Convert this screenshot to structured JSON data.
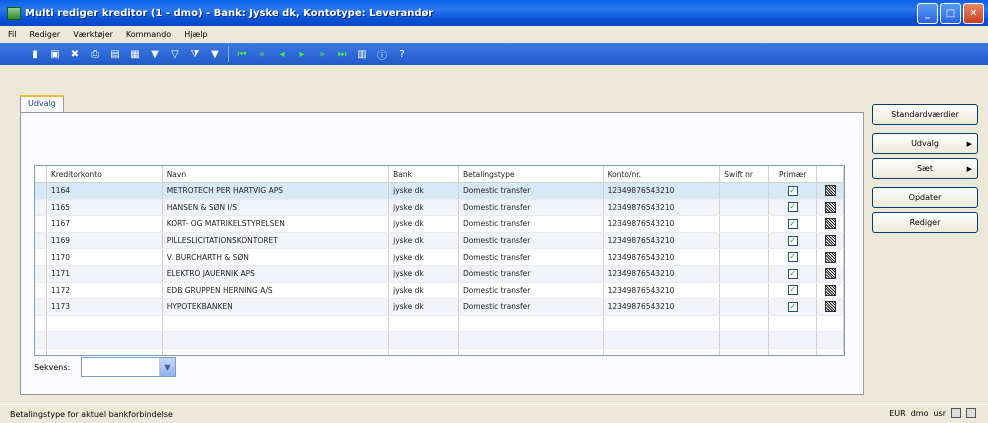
{
  "window": {
    "title": "Multi rediger kreditor (1 - dmo) - Bank: Jyske dk, Kontotype: Leverandør"
  },
  "menu": [
    "Fil",
    "Rediger",
    "Værktøjer",
    "Kommando",
    "Hjælp"
  ],
  "tab": {
    "label": "Udvalg"
  },
  "grid": {
    "columns": [
      "Kreditorkonto",
      "Navn",
      "Bank",
      "Betalingstype",
      "Konto/nr.",
      "Swift nr",
      "Primær"
    ],
    "rows": [
      {
        "konto": "1164",
        "navn": "METROTECH PER HARTVIG APS",
        "bank": "jyske dk",
        "type": "Domestic transfer",
        "kontonr": "12349876543210",
        "swift": "",
        "primaer": true
      },
      {
        "konto": "1165",
        "navn": "HANSEN & SØN I/S",
        "bank": "jyske dk",
        "type": "Domestic transfer",
        "kontonr": "12349876543210",
        "swift": "",
        "primaer": true
      },
      {
        "konto": "1167",
        "navn": "KORT- OG MATRIKELSTYRELSEN",
        "bank": "jyske dk",
        "type": "Domestic transfer",
        "kontonr": "12349876543210",
        "swift": "",
        "primaer": true
      },
      {
        "konto": "1169",
        "navn": "PILLESLICITATIONSKONTORET",
        "bank": "jyske dk",
        "type": "Domestic transfer",
        "kontonr": "12349876543210",
        "swift": "",
        "primaer": true
      },
      {
        "konto": "1170",
        "navn": "V. BURCHARTH & SØN",
        "bank": "jyske dk",
        "type": "Domestic transfer",
        "kontonr": "12349876543210",
        "swift": "",
        "primaer": true
      },
      {
        "konto": "1171",
        "navn": "ELEKTRO JAUERNIK APS",
        "bank": "jyske dk",
        "type": "Domestic transfer",
        "kontonr": "12349876543210",
        "swift": "",
        "primaer": true
      },
      {
        "konto": "1172",
        "navn": "EDB GRUPPEN HERNING A/S",
        "bank": "jyske dk",
        "type": "Domestic transfer",
        "kontonr": "12349876543210",
        "swift": "",
        "primaer": true
      },
      {
        "konto": "1173",
        "navn": "HYPOTEKBANKEN",
        "bank": "jyske dk",
        "type": "Domestic transfer",
        "kontonr": "12349876543210",
        "swift": "",
        "primaer": true
      }
    ]
  },
  "sekvens": {
    "label": "Sekvens:",
    "value": ""
  },
  "buttons": {
    "standard": "Standardværdier",
    "udvalg": "Udvalg",
    "saet": "Sæt",
    "opdater": "Opdater",
    "rediger": "Rediger"
  },
  "status": {
    "text": "Betalingstype for aktuel bankforbindelse",
    "currency": "EUR",
    "company": "dmo",
    "user": "usr"
  }
}
